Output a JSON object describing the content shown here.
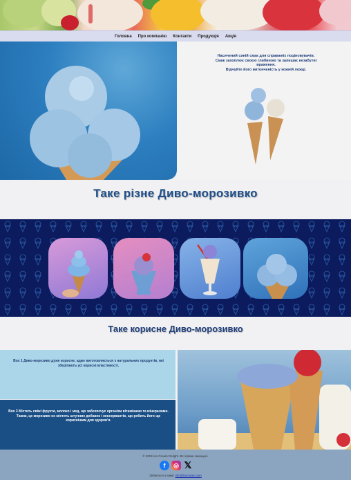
{
  "nav": {
    "items": [
      {
        "label": "Головна"
      },
      {
        "label": "Про компанію"
      },
      {
        "label": "Контакти"
      },
      {
        "label": "Продукція"
      },
      {
        "label": "Акція"
      }
    ]
  },
  "intro": {
    "lines": [
      "Насичений синій смак для справжніх поціновувачів.",
      "Смак захоплює своєю глибиною та залишає незабутні враження.",
      "Відчуйте його витонченість у кожній ложці."
    ]
  },
  "section_titles": {
    "variety": "Таке різне Диво-морозивко",
    "healthy": "Таке корисне Диво-морозивко"
  },
  "benefits": {
    "text1": "Вох 1 Диво-морозиво дуже корисне, адже виготовляється з натуральних продуктів, які зберігають усі корисні властивості.",
    "text2": "Вох 3 Містить свіжі фрукти, молоко і мед, що забезпечує організм вітамінами та мінералами. Також, це морозиво не містить штучних добавок і консервантів, що робить його ще кориснішим для здоров'я."
  },
  "footer": {
    "copyright": "© 2024 Ice Cream Delight. Всі права захищені.",
    "contact_prefix": "Зв'яжіться з нами:",
    "email": "info@icecream.com",
    "social": [
      {
        "icon": "facebook-icon",
        "color": "#1877f2"
      },
      {
        "icon": "instagram-icon",
        "color": "#e1306c"
      },
      {
        "icon": "x-icon",
        "color": "#000000"
      }
    ]
  },
  "colors": {
    "nav_bg": "#d9dbef",
    "band_bg": "#0c1b5e",
    "title_color": "#1f4f8a",
    "benefit1_bg": "#abd6ea",
    "benefit2_bg": "#1a4f86",
    "footer_bg": "#8ba4c0"
  }
}
